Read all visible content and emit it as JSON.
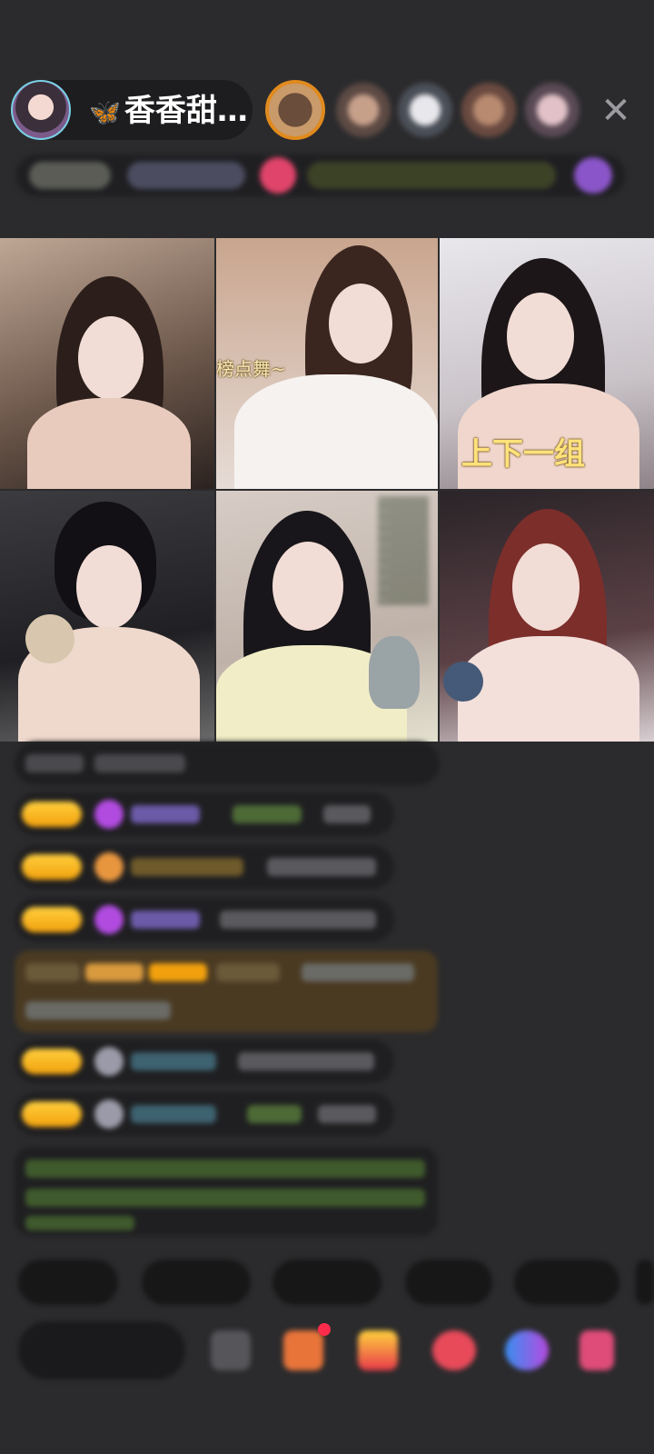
{
  "header": {
    "host_name": "香香甜…",
    "host_name_prefix_icon": "butterfly-icon",
    "viewer_avatars": [
      "viewer-1",
      "viewer-2",
      "viewer-3",
      "viewer-4",
      "viewer-5"
    ],
    "close_icon": "close-icon",
    "close_glyph": "✕"
  },
  "video_grid": {
    "tiles": [
      {
        "caption": ""
      },
      {
        "caption": "榜点舞~"
      },
      {
        "caption": "上下一组"
      },
      {
        "caption": ""
      },
      {
        "caption": ""
      },
      {
        "caption": ""
      }
    ]
  },
  "bottom": {
    "butterfly_glyph": "🦋"
  },
  "colors": {
    "background": "#2b2b2d",
    "pill": "#1d1d1f",
    "badge_gold": "#f2a10d",
    "caption_yellow": "#ffe27a",
    "accent_pink": "#e0446a",
    "accent_purple": "#8a55c8"
  }
}
